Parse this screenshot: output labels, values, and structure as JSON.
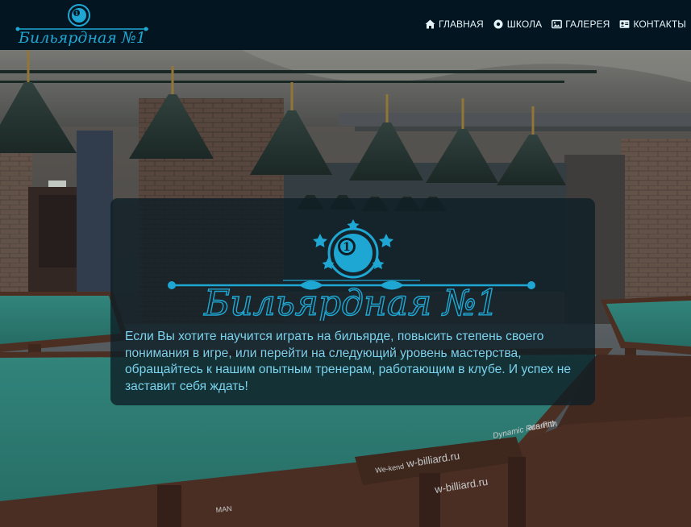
{
  "brand": {
    "logo_text": "Бильярдная №1",
    "emblem_number": "1",
    "accent_color": "#1fa7d4"
  },
  "nav": {
    "items": [
      {
        "label": "ГЛАВНАЯ",
        "icon": "home-icon"
      },
      {
        "label": "ШКОЛА",
        "icon": "record-icon"
      },
      {
        "label": "ГАЛЕРЕЯ",
        "icon": "image-icon"
      },
      {
        "label": "КОНТАКТЫ",
        "icon": "contact-card-icon"
      }
    ]
  },
  "hero": {
    "card": {
      "logo_text": "Бильярдная №1",
      "emblem_number": "1",
      "description": "Если Вы хотите научится играть на бильярде, повысить степень своего понимания в игре, или перейти на следующий уровень мастерства, обращайтесь к нашим опытным тренерам, работающим в клубе. И успех не заставит себя ждать!"
    },
    "table_branding": [
      "w-billiard.ru",
      "We-kend",
      "aramith",
      "Dynamic Rus-Pro",
      "MAN"
    ]
  },
  "colors": {
    "navbar_bg": "#031520",
    "card_text": "#7ad3ee",
    "logo_blue": "#1fa7d4",
    "table_cloth": "#2f8f84"
  }
}
